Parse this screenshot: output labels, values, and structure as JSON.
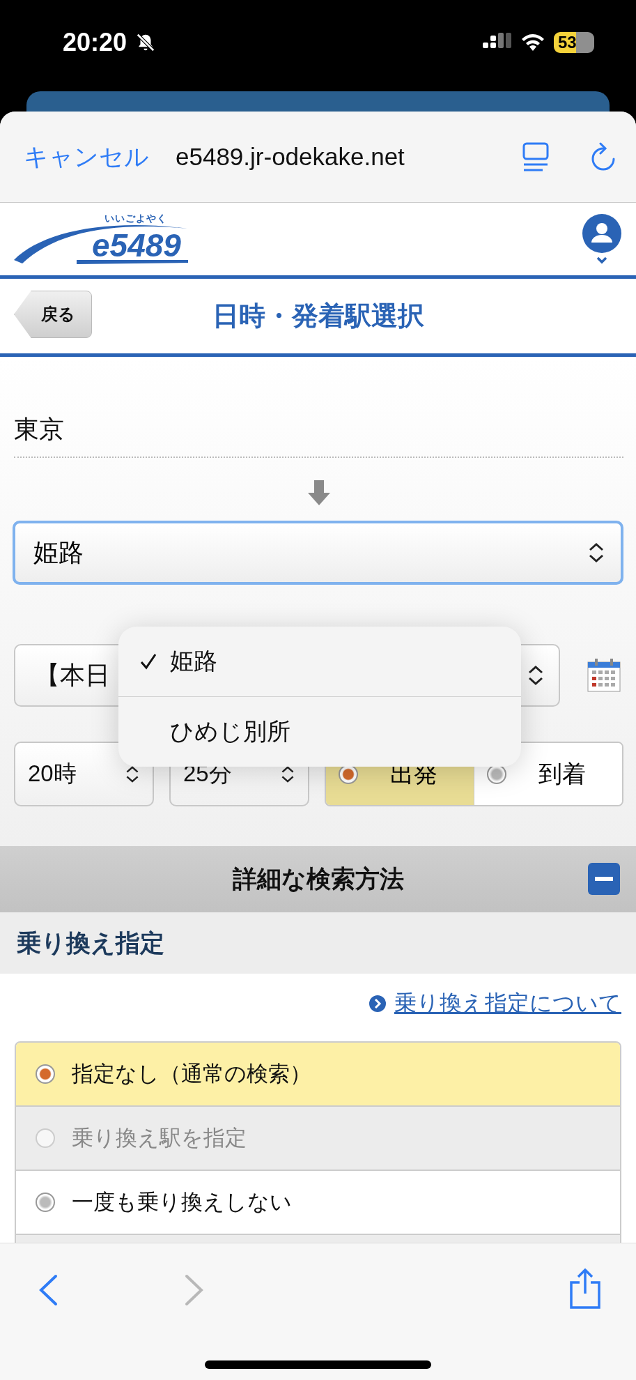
{
  "status_bar": {
    "time": "20:20",
    "battery": "53"
  },
  "browser": {
    "cancel": "キャンセル",
    "url": "e5489.jr-odekake.net"
  },
  "site": {
    "logo_ruby": "いいごよやく",
    "logo_text": "e5489"
  },
  "title_bar": {
    "back": "戻る",
    "title": "日時・発着駅選択"
  },
  "origin": "東京",
  "destination": {
    "value": "姫路",
    "focused": true
  },
  "date": {
    "value": "【本日"
  },
  "dropdown": {
    "options": [
      {
        "label": "姫路",
        "selected": true
      },
      {
        "label": "ひめじ別所",
        "selected": false
      }
    ]
  },
  "time": {
    "hour": "20時",
    "minute": "25分",
    "modes": [
      {
        "label": "出発",
        "selected": true
      },
      {
        "label": "到着",
        "selected": false
      }
    ]
  },
  "advanced": {
    "title": "詳細な検索方法",
    "expanded": true
  },
  "transfer": {
    "heading": "乗り換え指定",
    "link": "乗り換え指定について",
    "options": [
      {
        "label": "指定なし（通常の検索）",
        "selected": true,
        "disabled": false
      },
      {
        "label": "乗り換え駅を指定",
        "selected": false,
        "disabled": true
      },
      {
        "label": "一度も乗り換えしない",
        "selected": false,
        "disabled": false
      }
    ]
  },
  "toolbar": {
    "back_enabled": true,
    "forward_enabled": false
  }
}
